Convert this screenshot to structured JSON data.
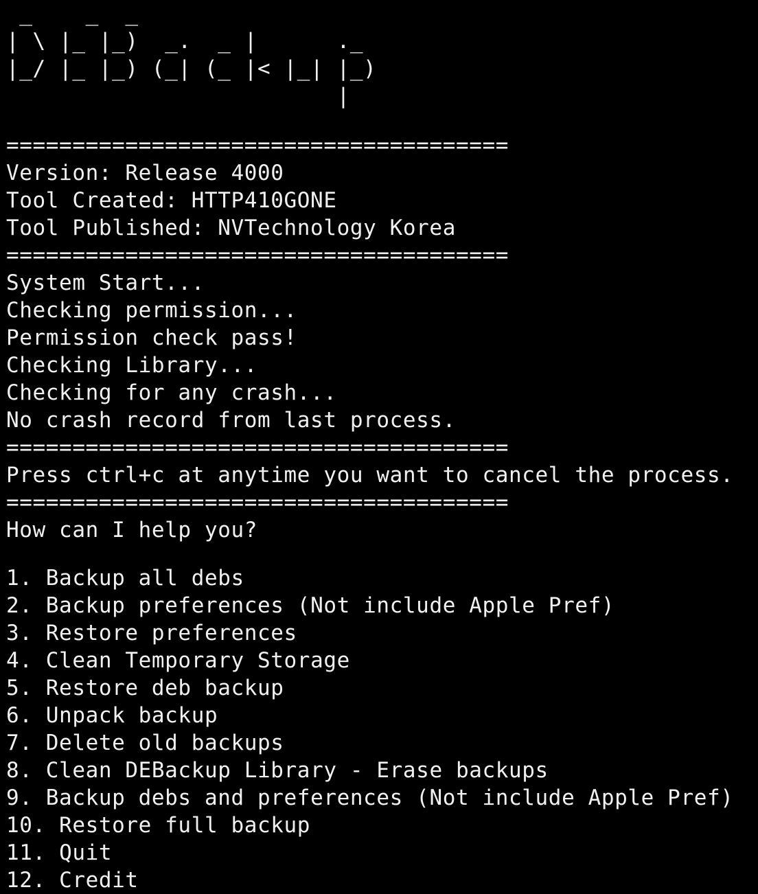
{
  "banner": {
    "ascii_art": " _    _  _\n| \\ |_ |_)  _.  _ |      ._\n|_/ |_ |_) (_| (_ |< |_| |_)\n                         |"
  },
  "separator": "======================================",
  "info": {
    "version": "Version: Release 4000",
    "created": "Tool Created: HTTP410GONE",
    "published": "Tool Published: NVTechnology Korea"
  },
  "log": [
    "System Start...",
    "Checking permission...",
    "Permission check pass!",
    "Checking Library...",
    "Checking for any crash...",
    "No crash record from last process."
  ],
  "cancel_hint": "Press ctrl+c at anytime you want to cancel the process.",
  "prompt": "How can I help you?",
  "menu": [
    {
      "num": "1.",
      "label": "Backup all debs"
    },
    {
      "num": "2.",
      "label": "Backup preferences (Not include Apple Pref)"
    },
    {
      "num": "3.",
      "label": "Restore preferences"
    },
    {
      "num": "4.",
      "label": "Clean Temporary Storage"
    },
    {
      "num": "5.",
      "label": "Restore deb backup"
    },
    {
      "num": "6.",
      "label": "Unpack backup"
    },
    {
      "num": "7.",
      "label": "Delete old backups"
    },
    {
      "num": "8.",
      "label": "Clean DEBackup Library - Erase backups"
    },
    {
      "num": "9.",
      "label": "Backup debs and preferences (Not include Apple Pref)"
    },
    {
      "num": "10.",
      "label": "Restore full backup"
    },
    {
      "num": "11.",
      "label": "Quit"
    },
    {
      "num": "12.",
      "label": "Credit"
    }
  ],
  "colors": {
    "background": "#000000",
    "foreground": "#f0f0f0"
  }
}
